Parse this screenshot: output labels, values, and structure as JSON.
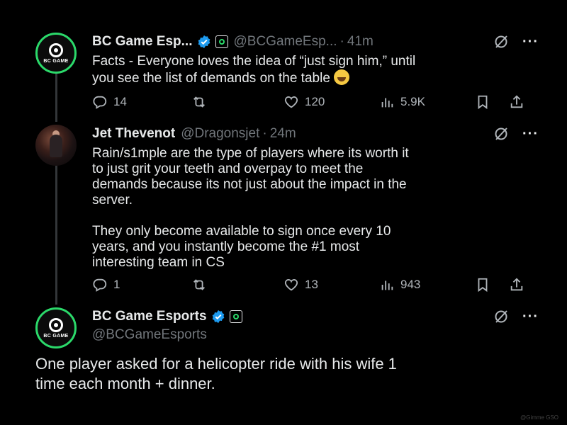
{
  "tweets": [
    {
      "name": "BC Game Esp...",
      "handle": "@BCGameEsp...",
      "separator": "·",
      "time": "41m",
      "avatar_text": "BC GAME",
      "text": "Facts - Everyone loves the idea of “just sign him,” until\nyou see the list of demands on the table ",
      "emoji_icon": "grinning-sweat-emoji",
      "replies": "14",
      "likes": "120",
      "views": "5.9K"
    },
    {
      "name": "Jet Thevenot",
      "handle": "@Dragonsjet",
      "separator": "·",
      "time": "24m",
      "text": "Rain/s1mple are the type of players where its worth it\nto just grit your teeth and overpay to meet the\ndemands because its not just about the impact in the\nserver.\n\nThey only become available to sign once every 10\nyears, and you instantly become the #1 most\ninteresting team in CS",
      "replies": "1",
      "likes": "13",
      "views": "943"
    },
    {
      "name": "BC Game Esports",
      "handle": "@BCGameEsports",
      "avatar_text": "BC GAME",
      "text": "One player asked for a helicopter ride with his wife 1\ntime each month + dinner."
    }
  ],
  "more_label": "···",
  "watermark": "@Gimme GSO",
  "colors": {
    "background": "#000000",
    "text": "#e7e9ea",
    "muted": "#71767b",
    "verified": "#1d9bf0",
    "brand_green": "#2bd96a"
  }
}
